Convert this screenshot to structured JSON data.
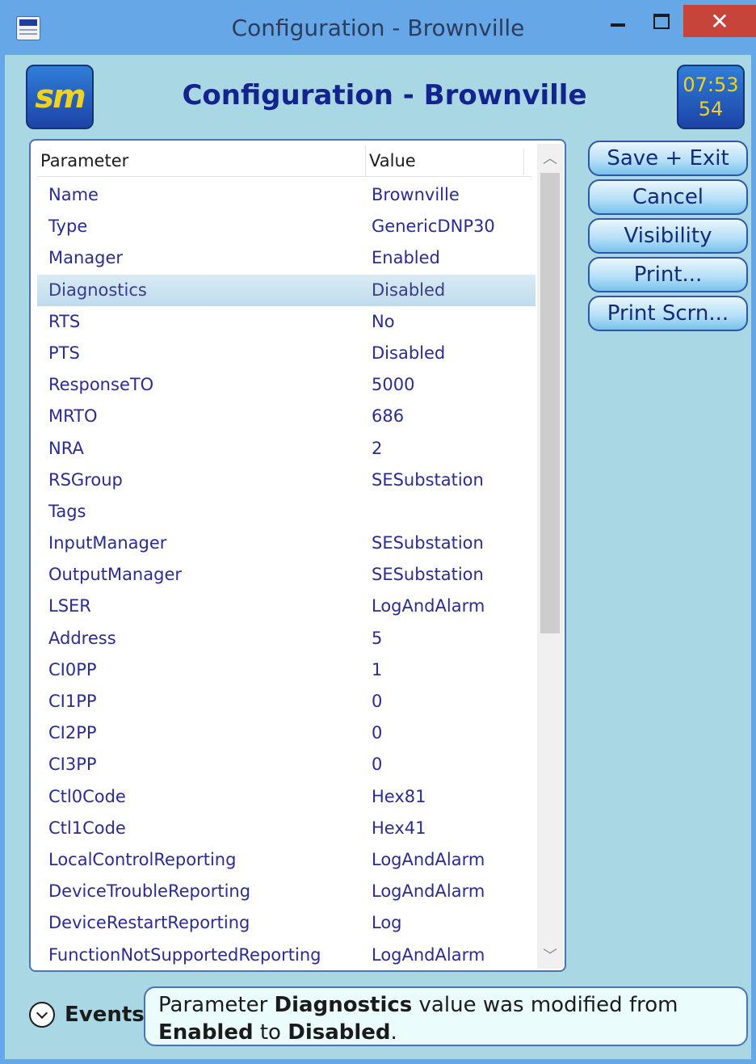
{
  "window": {
    "title": "Configuration - Brownville",
    "close_glyph": "✕"
  },
  "header": {
    "logo_text": "sm",
    "title": "Configuration - Brownville",
    "clock_time": "07:53",
    "clock_seconds": "54"
  },
  "table": {
    "columns": {
      "parameter": "Parameter",
      "value": "Value"
    },
    "rows": [
      {
        "p": "Name",
        "v": "Brownville"
      },
      {
        "p": "Type",
        "v": "GenericDNP30"
      },
      {
        "p": "Manager",
        "v": "Enabled"
      },
      {
        "p": "Diagnostics",
        "v": "Disabled"
      },
      {
        "p": "RTS",
        "v": "No"
      },
      {
        "p": "PTS",
        "v": "Disabled"
      },
      {
        "p": "ResponseTO",
        "v": "5000"
      },
      {
        "p": "MRTO",
        "v": "686"
      },
      {
        "p": "NRA",
        "v": "2"
      },
      {
        "p": "RSGroup",
        "v": "SESubstation"
      },
      {
        "p": "Tags",
        "v": ""
      },
      {
        "p": "InputManager",
        "v": "SESubstation"
      },
      {
        "p": "OutputManager",
        "v": "SESubstation"
      },
      {
        "p": "LSER",
        "v": "LogAndAlarm"
      },
      {
        "p": "Address",
        "v": "5"
      },
      {
        "p": "CI0PP",
        "v": "1"
      },
      {
        "p": "CI1PP",
        "v": "0"
      },
      {
        "p": "CI2PP",
        "v": "0"
      },
      {
        "p": "CI3PP",
        "v": "0"
      },
      {
        "p": "Ctl0Code",
        "v": "Hex81"
      },
      {
        "p": "Ctl1Code",
        "v": "Hex41"
      },
      {
        "p": "LocalControlReporting",
        "v": "LogAndAlarm"
      },
      {
        "p": "DeviceTroubleReporting",
        "v": "LogAndAlarm"
      },
      {
        "p": "DeviceRestartReporting",
        "v": "Log"
      },
      {
        "p": "FunctionNotSupportedReporting",
        "v": "LogAndAlarm"
      }
    ],
    "selected_row": "Diagnostics"
  },
  "buttons": {
    "save_exit": "Save + Exit",
    "cancel": "Cancel",
    "visibility": "Visibility",
    "print": "Print...",
    "print_screen": "Print Scrn..."
  },
  "events": {
    "label": "Events",
    "message": {
      "t1": "Parameter ",
      "param": "Diagnostics",
      "t2": " value was modified from ",
      "from": "Enabled",
      "t3": " to ",
      "to": "Disabled",
      "t4": "."
    }
  }
}
